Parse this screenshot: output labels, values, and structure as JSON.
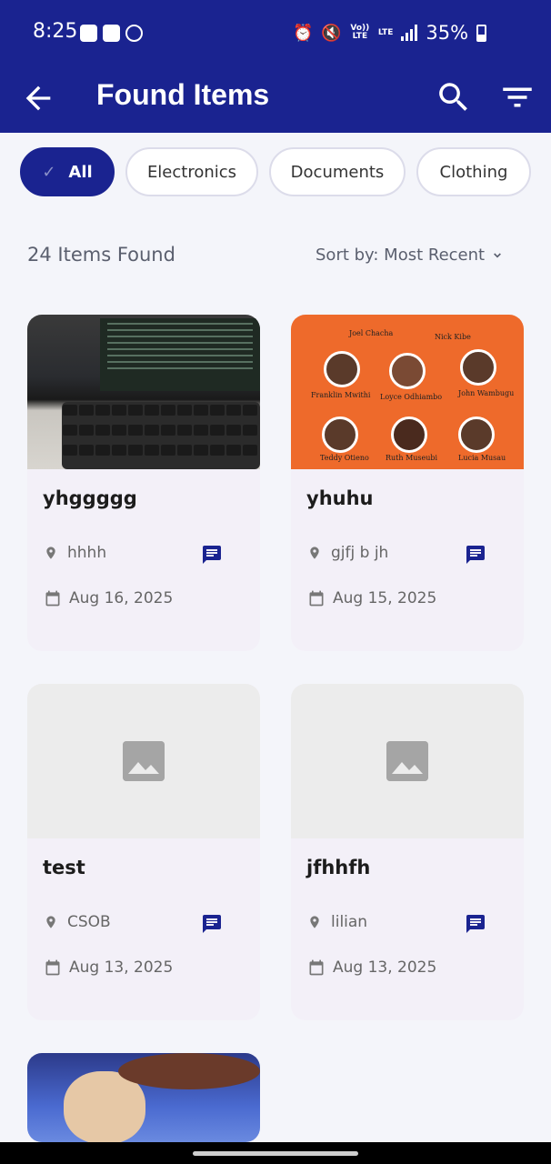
{
  "status_bar": {
    "time": "8:25",
    "volte": "Vo)) LTE",
    "lte": "LTE",
    "battery_percent": "35%"
  },
  "app_bar": {
    "title": "Found Items",
    "back_icon": "arrow-left-icon",
    "search_icon": "search-icon",
    "filter_icon": "filter-icon"
  },
  "filters": [
    {
      "label": "All",
      "selected": true
    },
    {
      "label": "Electronics",
      "selected": false
    },
    {
      "label": "Documents",
      "selected": false
    },
    {
      "label": "Clothing",
      "selected": false
    }
  ],
  "results": {
    "count_label": "24 Items Found",
    "sort_label": "Sort by: Most Recent"
  },
  "items": [
    {
      "title": "yhggggg",
      "location": "hhhh",
      "date": "Aug 16, 2025"
    },
    {
      "title": "yhuhu",
      "location": "gjfj b jh",
      "date": "Aug 15, 2025"
    },
    {
      "title": "test",
      "location": "CSOB",
      "date": "Aug 13, 2025"
    },
    {
      "title": "jfhhfh",
      "location": "lilian",
      "date": "Aug 13, 2025"
    }
  ],
  "poster": {
    "names": [
      "Joel Chacha",
      "Nick Kibe",
      "Franklin Mwithi",
      "Loyce Odhiambo",
      "John Wambugu",
      "Teddy Otieno",
      "Ruth Museubi",
      "Lucia Musau"
    ]
  },
  "colors": {
    "primary": "#1a2390",
    "background": "#f4f5fa",
    "card": "#f3f0f8"
  }
}
